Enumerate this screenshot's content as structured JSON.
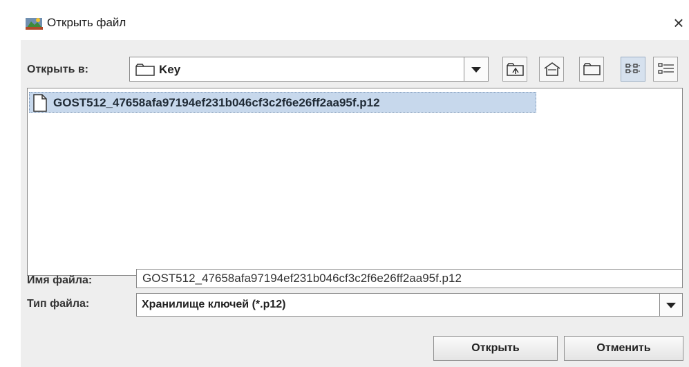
{
  "window": {
    "title": "Открыть файл",
    "close_glyph": "×"
  },
  "look_in": {
    "label": "Открыть в:",
    "value": "Key"
  },
  "toolbar": {
    "icons": [
      "up-one-level-icon",
      "home-icon",
      "new-folder-icon",
      "list-view-icon",
      "details-view-icon"
    ]
  },
  "files": [
    {
      "name": "GOST512_47658afa97194ef231b046cf3c2f6e26ff2aa95f.p12",
      "selected": true
    }
  ],
  "file_name": {
    "label": "Имя файла:",
    "value": "GOST512_47658afa97194ef231b046cf3c2f6e26ff2aa95f.p12"
  },
  "file_type": {
    "label": "Тип файла:",
    "value": "Хранилище ключей (*.p12)"
  },
  "buttons": {
    "open": "Открыть",
    "cancel": "Отменить"
  },
  "colors": {
    "selection": "#c7d8ec",
    "dialog_bg": "#eeeeee"
  }
}
